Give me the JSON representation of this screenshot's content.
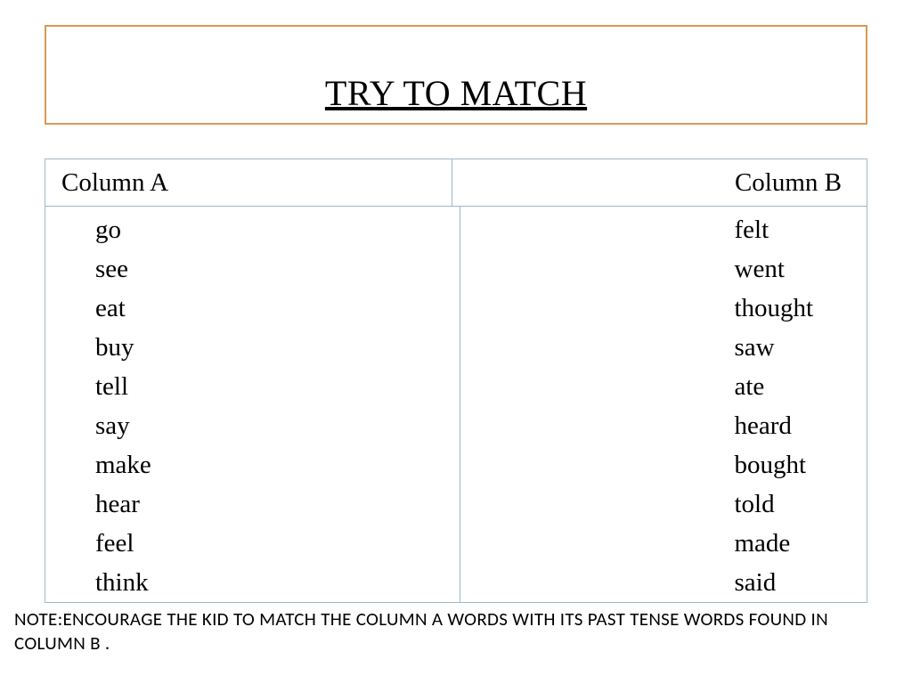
{
  "title": "TRY TO MATCH",
  "columns": {
    "a_header": "Column A",
    "b_header": "Column B",
    "a_words": [
      "go",
      "see",
      "eat",
      "buy",
      "tell",
      "say",
      "make",
      "hear",
      "feel",
      "think"
    ],
    "b_words": [
      "felt",
      "went",
      "thought",
      "saw",
      "ate",
      "heard",
      "bought",
      "told",
      "made",
      "said"
    ]
  },
  "note": "NOTE:ENCOURAGE THE KID TO MATCH THE COLUMN A WORDS WITH ITS PAST TENSE WORDS FOUND IN COLUMN B ."
}
